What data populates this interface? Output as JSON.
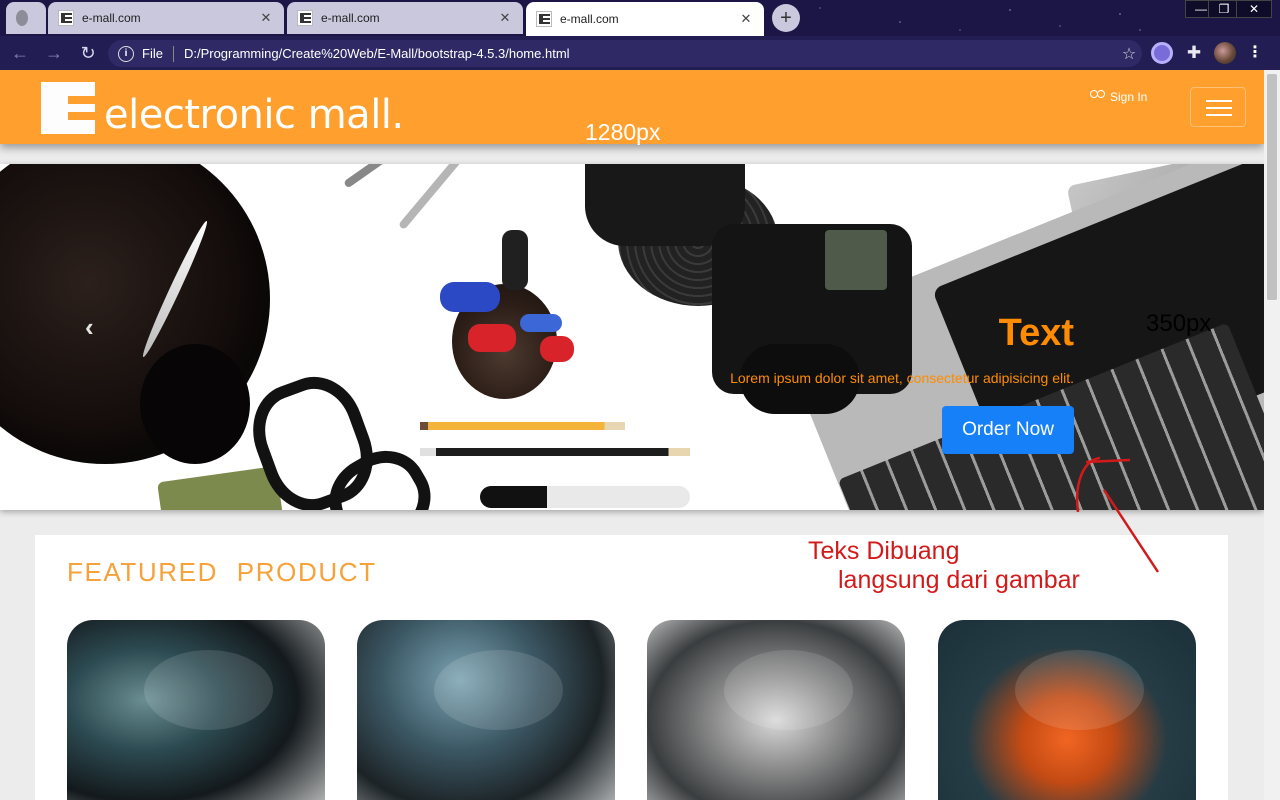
{
  "browser": {
    "tabs": [
      {
        "title": "",
        "active": false,
        "icon": "globe-icon"
      },
      {
        "title": "e-mall.com",
        "active": false,
        "icon": "e-mall-favicon-icon"
      },
      {
        "title": "e-mall.com",
        "active": false,
        "icon": "e-mall-favicon-icon"
      },
      {
        "title": "e-mall.com",
        "active": true,
        "icon": "e-mall-favicon-icon"
      }
    ],
    "new_tab_symbol": "+",
    "window_controls": {
      "minimize": "—",
      "maximize": "❐",
      "close": "✕"
    },
    "address": {
      "scheme_label": "File",
      "url": "D:/Programming/Create%20Web/E-Mall/bootstrap-4.5.3/home.html"
    }
  },
  "navbar": {
    "brand": "electronic mall.",
    "dimension_note": "1280px",
    "signin_label": "Sign In",
    "accent_color": "#ffa02e"
  },
  "hero": {
    "title": "Text",
    "subtitle": "Lorem ipsum dolor sit amet, consectetur adipisicing elit.",
    "button_label": "Order Now",
    "height_note": "350px",
    "prev_symbol": "‹"
  },
  "annotation": {
    "line1": "Teks Dibuang",
    "line2": "langsung dari gambar",
    "color": "#d21a1a"
  },
  "featured": {
    "heading": "FEATURED  PRODUCT",
    "cards": [
      {
        "subject": "motorcycle-tank-image"
      },
      {
        "subject": "motorcycle-engine-image"
      },
      {
        "subject": "motorcycle-lotus-image"
      },
      {
        "subject": "helmet-image"
      }
    ]
  }
}
